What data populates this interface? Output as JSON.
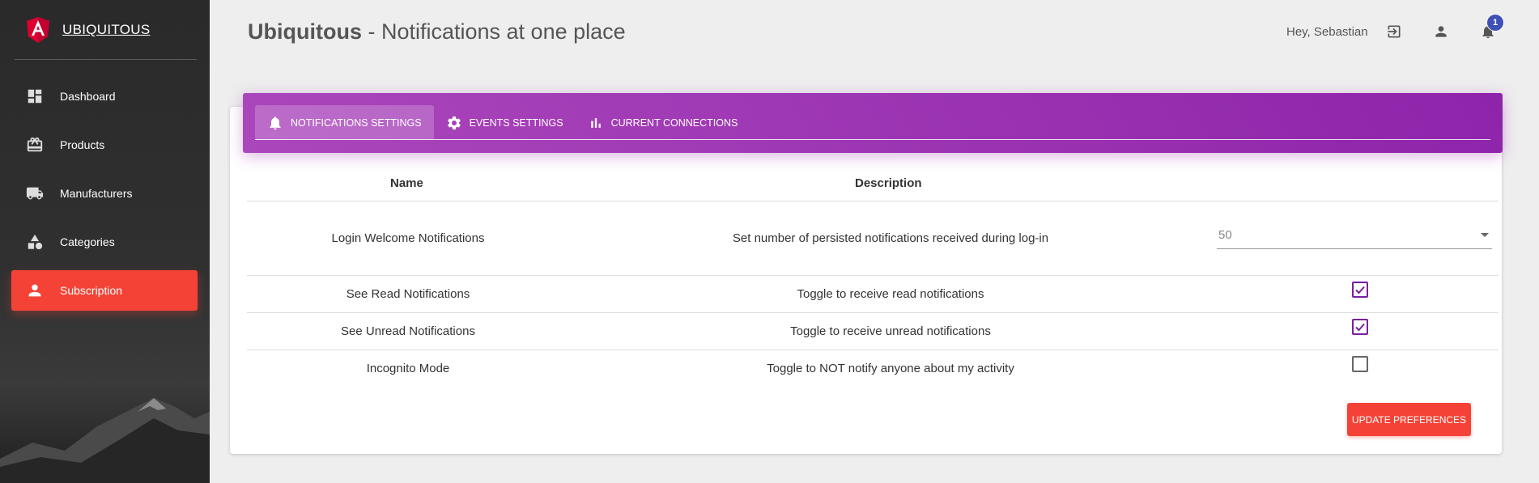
{
  "app": {
    "brand": "UBIQUITOUS",
    "title_bold": "Ubiquitous",
    "title_rest": " - Notifications at one place"
  },
  "header": {
    "greeting": "Hey, Sebastian",
    "notification_count": "1"
  },
  "sidebar": {
    "items": [
      {
        "label": "Dashboard",
        "icon": "dashboard-icon",
        "active": false
      },
      {
        "label": "Products",
        "icon": "products-icon",
        "active": false
      },
      {
        "label": "Manufacturers",
        "icon": "truck-icon",
        "active": false
      },
      {
        "label": "Categories",
        "icon": "category-icon",
        "active": false
      },
      {
        "label": "Subscription",
        "icon": "person-icon",
        "active": true
      }
    ]
  },
  "tabs": [
    {
      "label": "Notifications Settings",
      "icon": "bell-icon",
      "active": true
    },
    {
      "label": "Events Settings",
      "icon": "gear-icon",
      "active": false
    },
    {
      "label": "Current Connections",
      "icon": "signal-bars-icon",
      "active": false
    }
  ],
  "table": {
    "headers": {
      "name": "Name",
      "description": "Description"
    },
    "rows": [
      {
        "name": "Login Welcome Notifications",
        "description": "Set number of persisted notifications received during log-in",
        "control": "select",
        "value": "50"
      },
      {
        "name": "See Read Notifications",
        "description": "Toggle to receive read notifications",
        "control": "checkbox",
        "checked": true
      },
      {
        "name": "See Unread Notifications",
        "description": "Toggle to receive unread notifications",
        "control": "checkbox",
        "checked": true
      },
      {
        "name": "Incognito Mode",
        "description": "Toggle to NOT notify anyone about my activity",
        "control": "checkbox",
        "checked": false
      }
    ]
  },
  "actions": {
    "update_label": "Update Preferences"
  },
  "colors": {
    "accent_red": "#f44336",
    "header_purple": "#9c27b0",
    "checkbox_purple": "#7b1fa2",
    "badge_blue": "#3f51b5"
  }
}
